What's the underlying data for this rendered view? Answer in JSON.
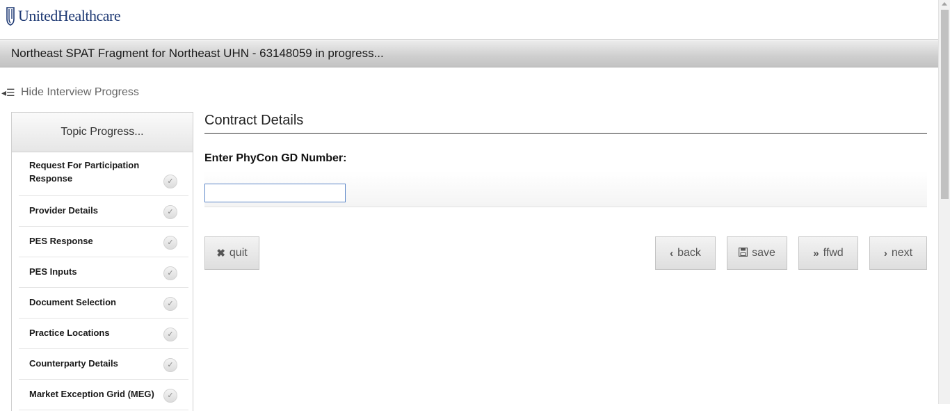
{
  "brand": {
    "logo_text": "UnitedHealthcare",
    "logo_icon": "uhc-shield-icon",
    "color": "#1f3a74"
  },
  "titlebar": {
    "title": "Northeast SPAT Fragment for Northeast UHN - 63148059 in progress..."
  },
  "progress_toggle": {
    "icon": "collapse-menu-icon",
    "label": "Hide Interview Progress"
  },
  "sidebar": {
    "header": "Topic Progress...",
    "items": [
      {
        "label": "Request For Participation Response",
        "status": "complete"
      },
      {
        "label": "Provider Details",
        "status": "complete"
      },
      {
        "label": "PES Response",
        "status": "complete"
      },
      {
        "label": "PES Inputs",
        "status": "complete"
      },
      {
        "label": "Document Selection",
        "status": "complete"
      },
      {
        "label": "Practice Locations",
        "status": "complete"
      },
      {
        "label": "Counterparty Details",
        "status": "complete"
      },
      {
        "label": "Market Exception Grid (MEG)",
        "status": "complete"
      }
    ]
  },
  "main": {
    "heading": "Contract Details",
    "field_label": "Enter PhyCon GD Number:",
    "field_value": "",
    "field_placeholder": ""
  },
  "buttons": {
    "quit": {
      "label": "quit",
      "icon": "x-icon"
    },
    "back": {
      "label": "back",
      "icon": "chevron-left-icon"
    },
    "save": {
      "label": "save",
      "icon": "floppy-disk-icon"
    },
    "ffwd": {
      "label": "ffwd",
      "icon": "double-chevron-right-icon"
    },
    "next": {
      "label": "next",
      "icon": "chevron-right-icon"
    }
  }
}
